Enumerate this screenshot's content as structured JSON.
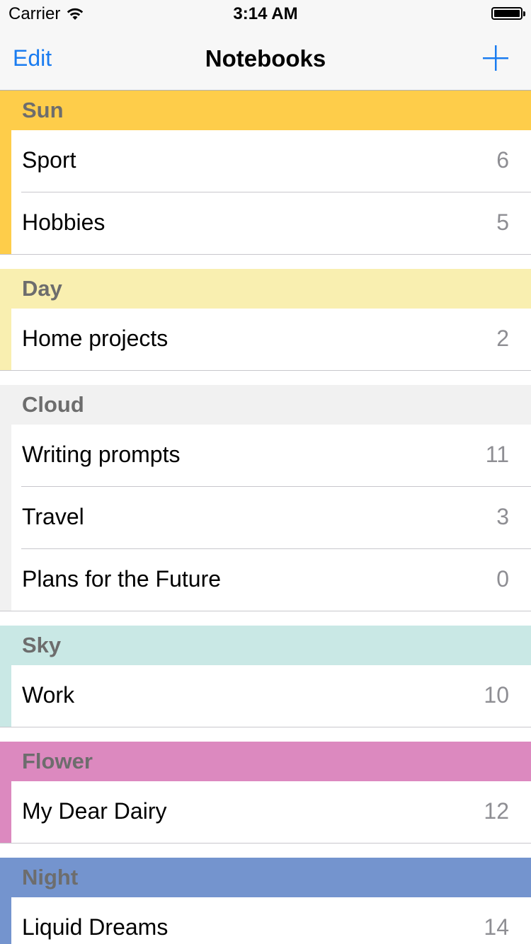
{
  "status_bar": {
    "carrier": "Carrier",
    "time": "3:14 AM"
  },
  "nav": {
    "edit_label": "Edit",
    "title": "Notebooks",
    "add_icon": "plus-icon",
    "accent_color": "#1a7cf0"
  },
  "sections": [
    {
      "title": "Sun",
      "color": "#fecd4a",
      "items": [
        {
          "label": "Sport",
          "count": "6"
        },
        {
          "label": "Hobbies",
          "count": "5"
        }
      ]
    },
    {
      "title": "Day",
      "color": "#f9efb0",
      "items": [
        {
          "label": "Home projects",
          "count": "2"
        }
      ]
    },
    {
      "title": "Cloud",
      "color": "#f1f1f1",
      "items": [
        {
          "label": "Writing prompts",
          "count": "11"
        },
        {
          "label": "Travel",
          "count": "3"
        },
        {
          "label": "Plans for the Future",
          "count": "0"
        }
      ]
    },
    {
      "title": "Sky",
      "color": "#c9e8e5",
      "items": [
        {
          "label": "Work",
          "count": "10"
        }
      ]
    },
    {
      "title": "Flower",
      "color": "#dc89bf",
      "items": [
        {
          "label": "My Dear Dairy",
          "count": "12"
        }
      ]
    },
    {
      "title": "Night",
      "color": "#7494ce",
      "items": [
        {
          "label": "Liquid Dreams",
          "count": "14"
        }
      ]
    }
  ]
}
